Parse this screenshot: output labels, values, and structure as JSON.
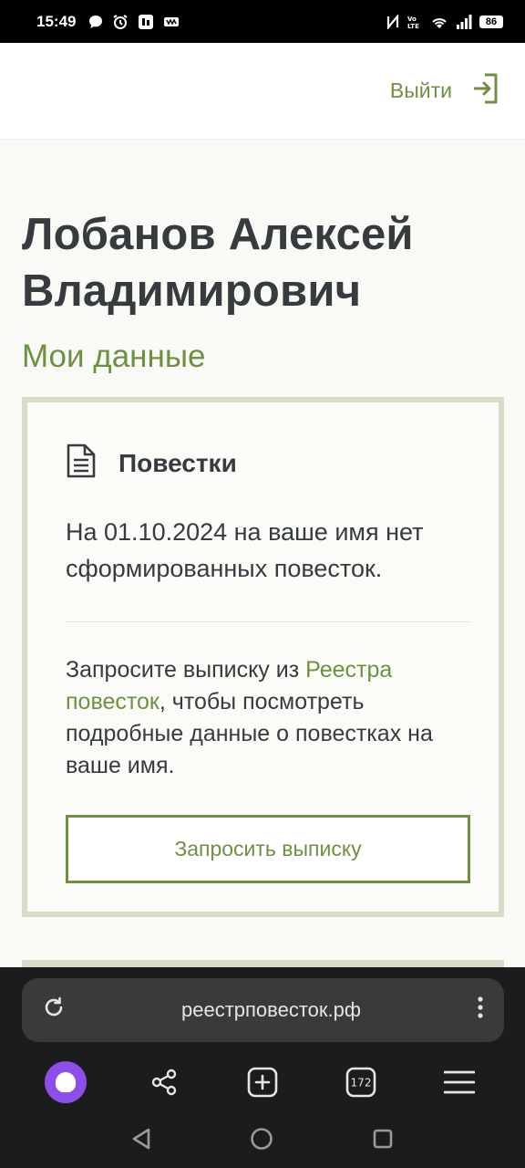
{
  "status_bar": {
    "time": "15:49",
    "battery": "86"
  },
  "header": {
    "logout_label": "Выйти"
  },
  "profile": {
    "full_name": "Лобанов Алексей Владимирович",
    "section_title": "Мои данные"
  },
  "card": {
    "title": "Повестки",
    "status_text": "На 01.10.2024 на ваше имя нет сформированных повесток.",
    "note_prefix": "Запросите выписку из ",
    "note_link": "Реестра повесток",
    "note_suffix": ", чтобы посмотреть подробные данные о повестках на ваше имя.",
    "button_label": "Запросить выписку"
  },
  "browser": {
    "url": "реестрповесток.рф",
    "tabs_count": "172"
  },
  "colors": {
    "accent": "#6f9044",
    "text": "#363b40",
    "card_border": "#d9dbc8",
    "browser_bg": "#1c1c1e"
  }
}
